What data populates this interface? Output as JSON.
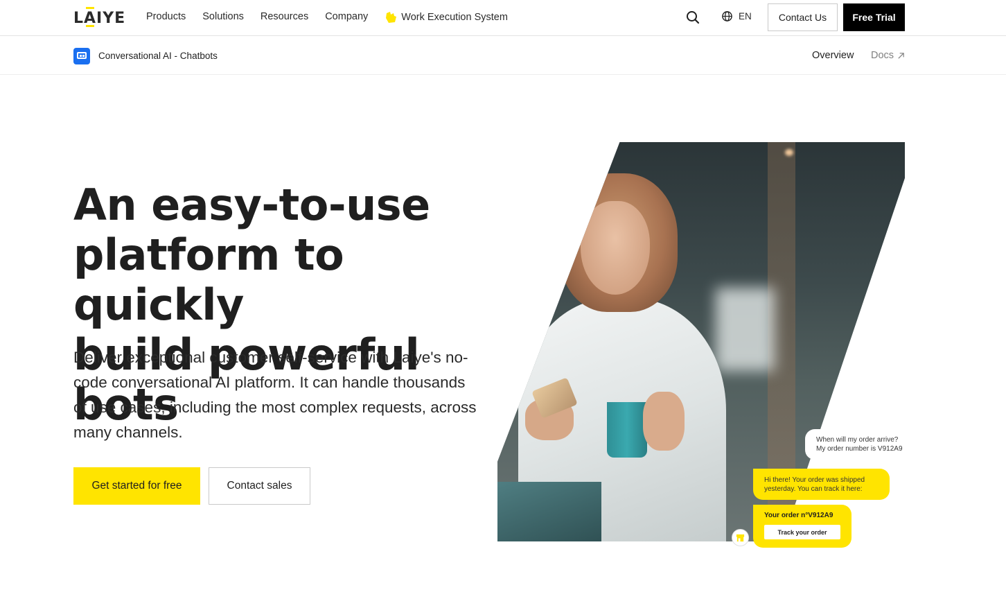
{
  "header": {
    "logo_text": "LAIYE",
    "nav": [
      {
        "label": "Products"
      },
      {
        "label": "Solutions"
      },
      {
        "label": "Resources"
      },
      {
        "label": "Company"
      },
      {
        "label": "Work Execution System",
        "icon": "hand-wave-icon"
      }
    ],
    "search_icon": "search-icon",
    "language": {
      "icon": "globe-icon",
      "label": "EN"
    },
    "contact_us_label": "Contact Us",
    "free_trial_label": "Free Trial"
  },
  "subnav": {
    "product_icon": "chatbot-icon",
    "product_name": "Conversational AI - Chatbots",
    "overview_label": "Overview",
    "docs_label": "Docs",
    "docs_icon": "external-link-arrow-icon"
  },
  "hero": {
    "title_lines": [
      "An easy-to-use",
      "platform to quickly",
      "build powerful bots"
    ],
    "description": "Deliver exceptional customer self-service with Laiye's no-code conversational AI platform. It can handle thousands of use cases, including the most complex requests, across many channels.",
    "primary_cta": "Get started for free",
    "secondary_cta": "Contact sales"
  },
  "chat": {
    "user_message": [
      "When will my order arrive?",
      "My order number is V912A9"
    ],
    "bot_message": [
      "Hi there! Your order was shipped",
      "yesterday. You can track it here:"
    ],
    "order_label": "Your order n°V912A9",
    "track_button": "Track your order",
    "bot_avatar_icon": "store-icon"
  },
  "colors": {
    "brand_yellow": "#ffe400",
    "brand_black": "#000000",
    "product_blue": "#1a6ff0",
    "text_dark": "#1f1f1f",
    "text_muted": "#808080"
  }
}
